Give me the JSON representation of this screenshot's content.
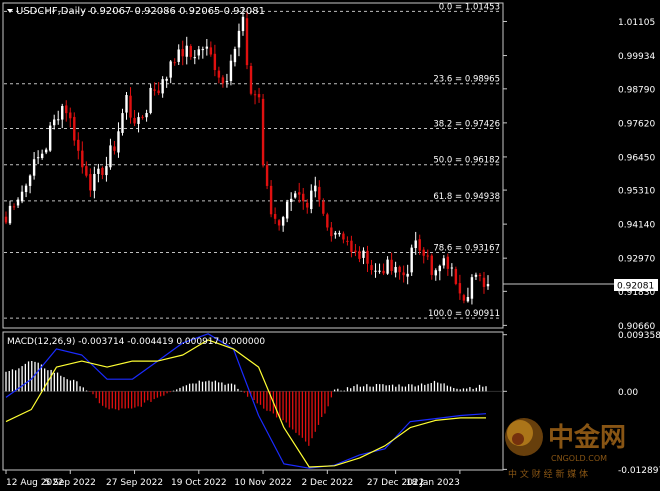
{
  "header": {
    "symbol_label": "USDCHF,Daily",
    "ohlc_label": "0.92067 0.92086 0.92065 0.92081",
    "macd_label": "MACD(12,26,9) -0.003714 -0.004419 0.000917 0.000000"
  },
  "colors": {
    "background": "#000000",
    "frame": "#c8c8c8",
    "text": "#ffffff",
    "grid_dashed": "#c0c0c0",
    "bull": "#ffffff",
    "bear": "#e01010",
    "macd_line": "#1a2bff",
    "signal_line": "#ffff33",
    "hist_pos": "#ffffff",
    "hist_neg": "#e01010",
    "price_box_bg": "#ffffff",
    "price_box_text": "#000000"
  },
  "chart_data": [
    {
      "type": "candlestick",
      "title": "USDCHF,Daily",
      "ylim": [
        0.9057,
        1.0174
      ],
      "price_axis_ticks": [
        "1.01105",
        "0.99934",
        "0.98790",
        "0.97620",
        "0.96450",
        "0.95310",
        "0.94140",
        "0.92970",
        "0.91830",
        "0.90660"
      ],
      "x_axis_ticks": [
        "12 Aug 2022",
        "5 Sep 2022",
        "27 Sep 2022",
        "19 Oct 2022",
        "10 Nov 2022",
        "2 Dec 2022",
        "27 Dec 2022",
        "18 Jan 2023"
      ],
      "current_price": "0.92081",
      "fibonacci_levels": [
        {
          "label": "0.0 = 1.01453",
          "value": 1.01453
        },
        {
          "label": "23.6 = 0.98965",
          "value": 0.98965
        },
        {
          "label": "38.2 = 0.97426",
          "value": 0.97426
        },
        {
          "label": "50.0 = 0.96182",
          "value": 0.96182
        },
        {
          "label": "61.8 = 0.94938",
          "value": 0.94938
        },
        {
          "label": "78.6 = 0.93167",
          "value": 0.93167
        },
        {
          "label": "100.0 = 0.90911",
          "value": 0.90911
        }
      ],
      "close_anchors": [
        [
          "2022-08-12",
          0.942
        ],
        [
          "2022-08-22",
          0.96
        ],
        [
          "2022-08-29",
          0.974
        ],
        [
          "2022-09-01",
          0.982
        ],
        [
          "2022-09-05",
          0.977
        ],
        [
          "2022-09-08",
          0.961
        ],
        [
          "2022-09-12",
          0.955
        ],
        [
          "2022-09-15",
          0.96
        ],
        [
          "2022-09-20",
          0.968
        ],
        [
          "2022-09-23",
          0.985
        ],
        [
          "2022-09-26",
          0.979
        ],
        [
          "2022-09-28",
          0.976
        ],
        [
          "2022-10-03",
          0.988
        ],
        [
          "2022-10-05",
          0.988
        ],
        [
          "2022-10-10",
          0.998
        ],
        [
          "2022-10-14",
          1.001
        ],
        [
          "2022-10-17",
          0.999
        ],
        [
          "2022-10-20",
          1.002
        ],
        [
          "2022-10-24",
          0.999
        ],
        [
          "2022-10-27",
          0.99
        ],
        [
          "2022-11-01",
          1.002
        ],
        [
          "2022-11-03",
          1.012
        ],
        [
          "2022-11-04",
          0.994
        ],
        [
          "2022-11-07",
          0.987
        ],
        [
          "2022-11-09",
          0.985
        ],
        [
          "2022-11-10",
          0.962
        ],
        [
          "2022-11-11",
          0.953
        ],
        [
          "2022-11-14",
          0.945
        ],
        [
          "2022-11-16",
          0.942
        ],
        [
          "2022-11-18",
          0.948
        ],
        [
          "2022-11-22",
          0.953
        ],
        [
          "2022-11-25",
          0.945
        ],
        [
          "2022-11-29",
          0.953
        ],
        [
          "2022-12-02",
          0.94
        ],
        [
          "2022-12-07",
          0.939
        ],
        [
          "2022-12-12",
          0.931
        ],
        [
          "2022-12-16",
          0.93
        ],
        [
          "2022-12-20",
          0.925
        ],
        [
          "2022-12-23",
          0.927
        ],
        [
          "2022-12-29",
          0.924
        ],
        [
          "2023-01-03",
          0.934
        ],
        [
          "2023-01-06",
          0.932
        ],
        [
          "2023-01-09",
          0.923
        ],
        [
          "2023-01-12",
          0.928
        ],
        [
          "2023-01-16",
          0.925
        ],
        [
          "2023-01-19",
          0.917
        ],
        [
          "2023-01-23",
          0.923
        ],
        [
          "2023-01-25",
          0.922
        ],
        [
          "2023-01-27",
          0.9208
        ]
      ]
    },
    {
      "type": "line",
      "title": "MACD(12,26,9)",
      "ylim": [
        -0.013,
        0.0098
      ],
      "axis_ticks": [
        "0.009358",
        "0.00",
        "-0.012897"
      ],
      "series": [
        {
          "name": "MACD",
          "values": [
            -0.001,
            0.002,
            0.007,
            0.006,
            0.002,
            0.002,
            0.005,
            0.008,
            0.0095,
            0.007,
            -0.004,
            -0.012,
            -0.0127,
            -0.0122,
            -0.0105,
            -0.0095,
            -0.005,
            -0.0045,
            -0.004,
            -0.0037
          ]
        },
        {
          "name": "Signal",
          "values": [
            -0.005,
            -0.003,
            0.004,
            0.005,
            0.004,
            0.005,
            0.005,
            0.006,
            0.0085,
            0.007,
            0.004,
            -0.006,
            -0.0125,
            -0.0123,
            -0.011,
            -0.009,
            -0.006,
            -0.0048,
            -0.0044,
            -0.0044
          ]
        }
      ],
      "histogram": [
        0.003,
        0.005,
        0.003,
        0.001,
        -0.003,
        -0.003,
        -0.001,
        0.001,
        0.002,
        0.001,
        -0.002,
        -0.005,
        -0.009,
        0.0,
        0.001,
        0.001,
        0.001,
        0.0015,
        0.0005,
        0.0009
      ]
    }
  ],
  "watermark": {
    "brand": "中金网",
    "domain": "CNGOLD.COM",
    "slogan": "中 文 财 经 新 媒 体"
  }
}
